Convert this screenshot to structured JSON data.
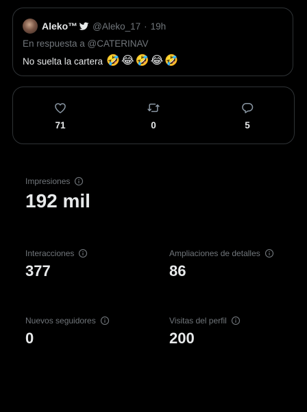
{
  "tweet": {
    "display_name": "Aleko™",
    "handle": "@Aleko_17",
    "separator": "·",
    "time": "19h",
    "reply_to": "En respuesta a @CATERINAV",
    "text": "No suelta la cartera",
    "emojis": [
      "🤣",
      "😂",
      "🤣",
      "😂",
      "🤣"
    ]
  },
  "engagement": {
    "likes": "71",
    "retweets": "0",
    "replies": "5"
  },
  "metrics": {
    "impresiones": {
      "label": "Impresiones",
      "value": "192 mil"
    },
    "interacciones": {
      "label": "Interacciones",
      "value": "377"
    },
    "ampliaciones": {
      "label": "Ampliaciones de detalles",
      "value": "86"
    },
    "seguidores": {
      "label": "Nuevos seguidores",
      "value": "0"
    },
    "visitas": {
      "label": "Visitas del perfil",
      "value": "200"
    }
  },
  "colors": {
    "background": "#000000",
    "text_primary": "#e7e9ea",
    "text_secondary": "#71767b",
    "border": "#2f3336"
  },
  "icons": {
    "verified": "twitter-bird-icon",
    "like": "heart-icon",
    "retweet": "retweet-icon",
    "reply": "reply-bubble-icon",
    "info": "info-icon"
  }
}
